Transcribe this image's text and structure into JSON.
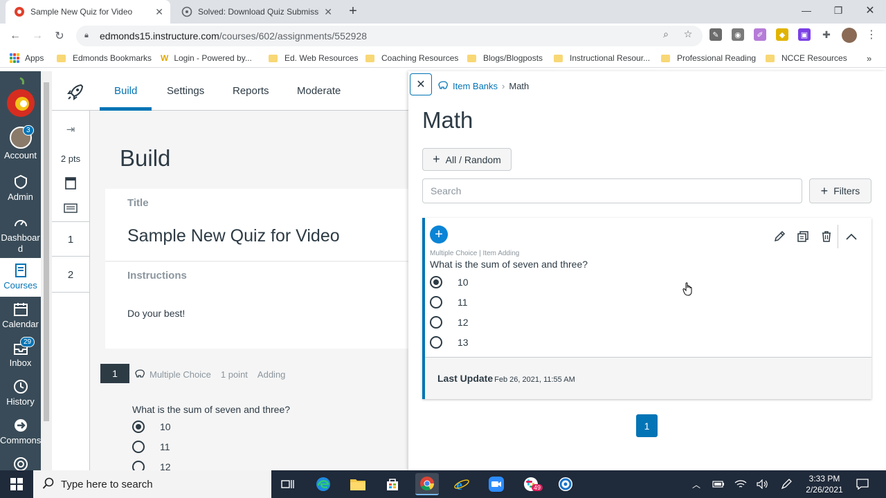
{
  "browser": {
    "tabs": [
      {
        "title": "Sample New Quiz for Video",
        "active": true
      },
      {
        "title": "Solved: Download Quiz Submissi",
        "active": false
      }
    ],
    "url_host": "edmonds15.instructure.com",
    "url_path": "/courses/602/assignments/552928",
    "bookmarks": [
      "Apps",
      "Edmonds Bookmarks",
      "Login - Powered by...",
      "Ed. Web Resources",
      "Coaching Resources",
      "Blogs/Blogposts",
      "Instructional Resour...",
      "Professional Reading",
      "NCCE Resources"
    ]
  },
  "globalnav": {
    "items": [
      {
        "label": "Account",
        "badge": "3"
      },
      {
        "label": "Admin"
      },
      {
        "label": "Dashboard_line1",
        "text": "Dashboar"
      },
      {
        "label": "Courses"
      },
      {
        "label": "Calendar"
      },
      {
        "label": "Inbox",
        "badge": "29"
      },
      {
        "label": "History"
      },
      {
        "label": "Commons"
      }
    ],
    "dash_l1": "Dashboar",
    "dash_l2": "d"
  },
  "builder": {
    "tabs": [
      "Build",
      "Settings",
      "Reports",
      "Moderate"
    ],
    "side": {
      "points": "2 pts",
      "q1": "1",
      "q2": "2"
    },
    "heading": "Build",
    "title_label": "Title",
    "quiz_title": "Sample New Quiz for Video",
    "instructions_label": "Instructions",
    "instructions": "Do your best!",
    "question": {
      "number": "1",
      "type": "Multiple Choice",
      "points": "1 point",
      "topic": "Adding",
      "stem": "What is the sum of seven and three?",
      "answers": [
        "10",
        "11",
        "12"
      ]
    }
  },
  "tray": {
    "breadcrumb_root": "Item Banks",
    "breadcrumb_current": "Math",
    "title": "Math",
    "all_random": "All / Random",
    "search_placeholder": "Search",
    "filters": "Filters",
    "item": {
      "meta": "Multiple Choice | Item Adding",
      "stem": "What is the sum of seven and three?",
      "answers": [
        "10",
        "11",
        "12",
        "13"
      ],
      "last_update_label": "Last Update",
      "last_update_date": "Feb 26, 2021, 11:55 AM"
    },
    "page": "1"
  },
  "taskbar": {
    "search_placeholder": "Type here to search",
    "time": "3:33 PM",
    "date": "2/26/2021",
    "slack_badge": "49"
  },
  "colors": {
    "canvas_blue": "#0374b5",
    "nav_bg": "#394b58"
  }
}
